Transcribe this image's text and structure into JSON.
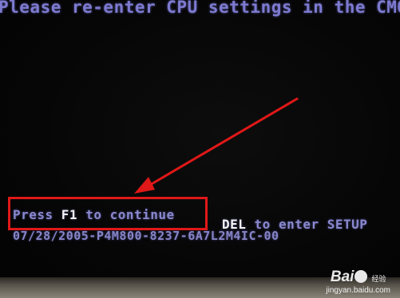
{
  "screen": {
    "top_message": "Please re-enter CPU settings in the CMO",
    "press_prefix": "Press ",
    "f1_key": "F1",
    "press_suffix": " to continue",
    "del_key": "DEL",
    "del_suffix": " to enter SETUP",
    "bios_string": "07/28/2005-P4M800-8237-6A7L2M4IC-00"
  },
  "watermark": {
    "logo_left": "Bai",
    "logo_right": "经验",
    "url": "jingyan.baidu.com"
  },
  "colors": {
    "background": "#050505",
    "bios_text": "#8a88cf",
    "key_highlight": "#f4f4f4",
    "annotation_red": "#e01818"
  }
}
